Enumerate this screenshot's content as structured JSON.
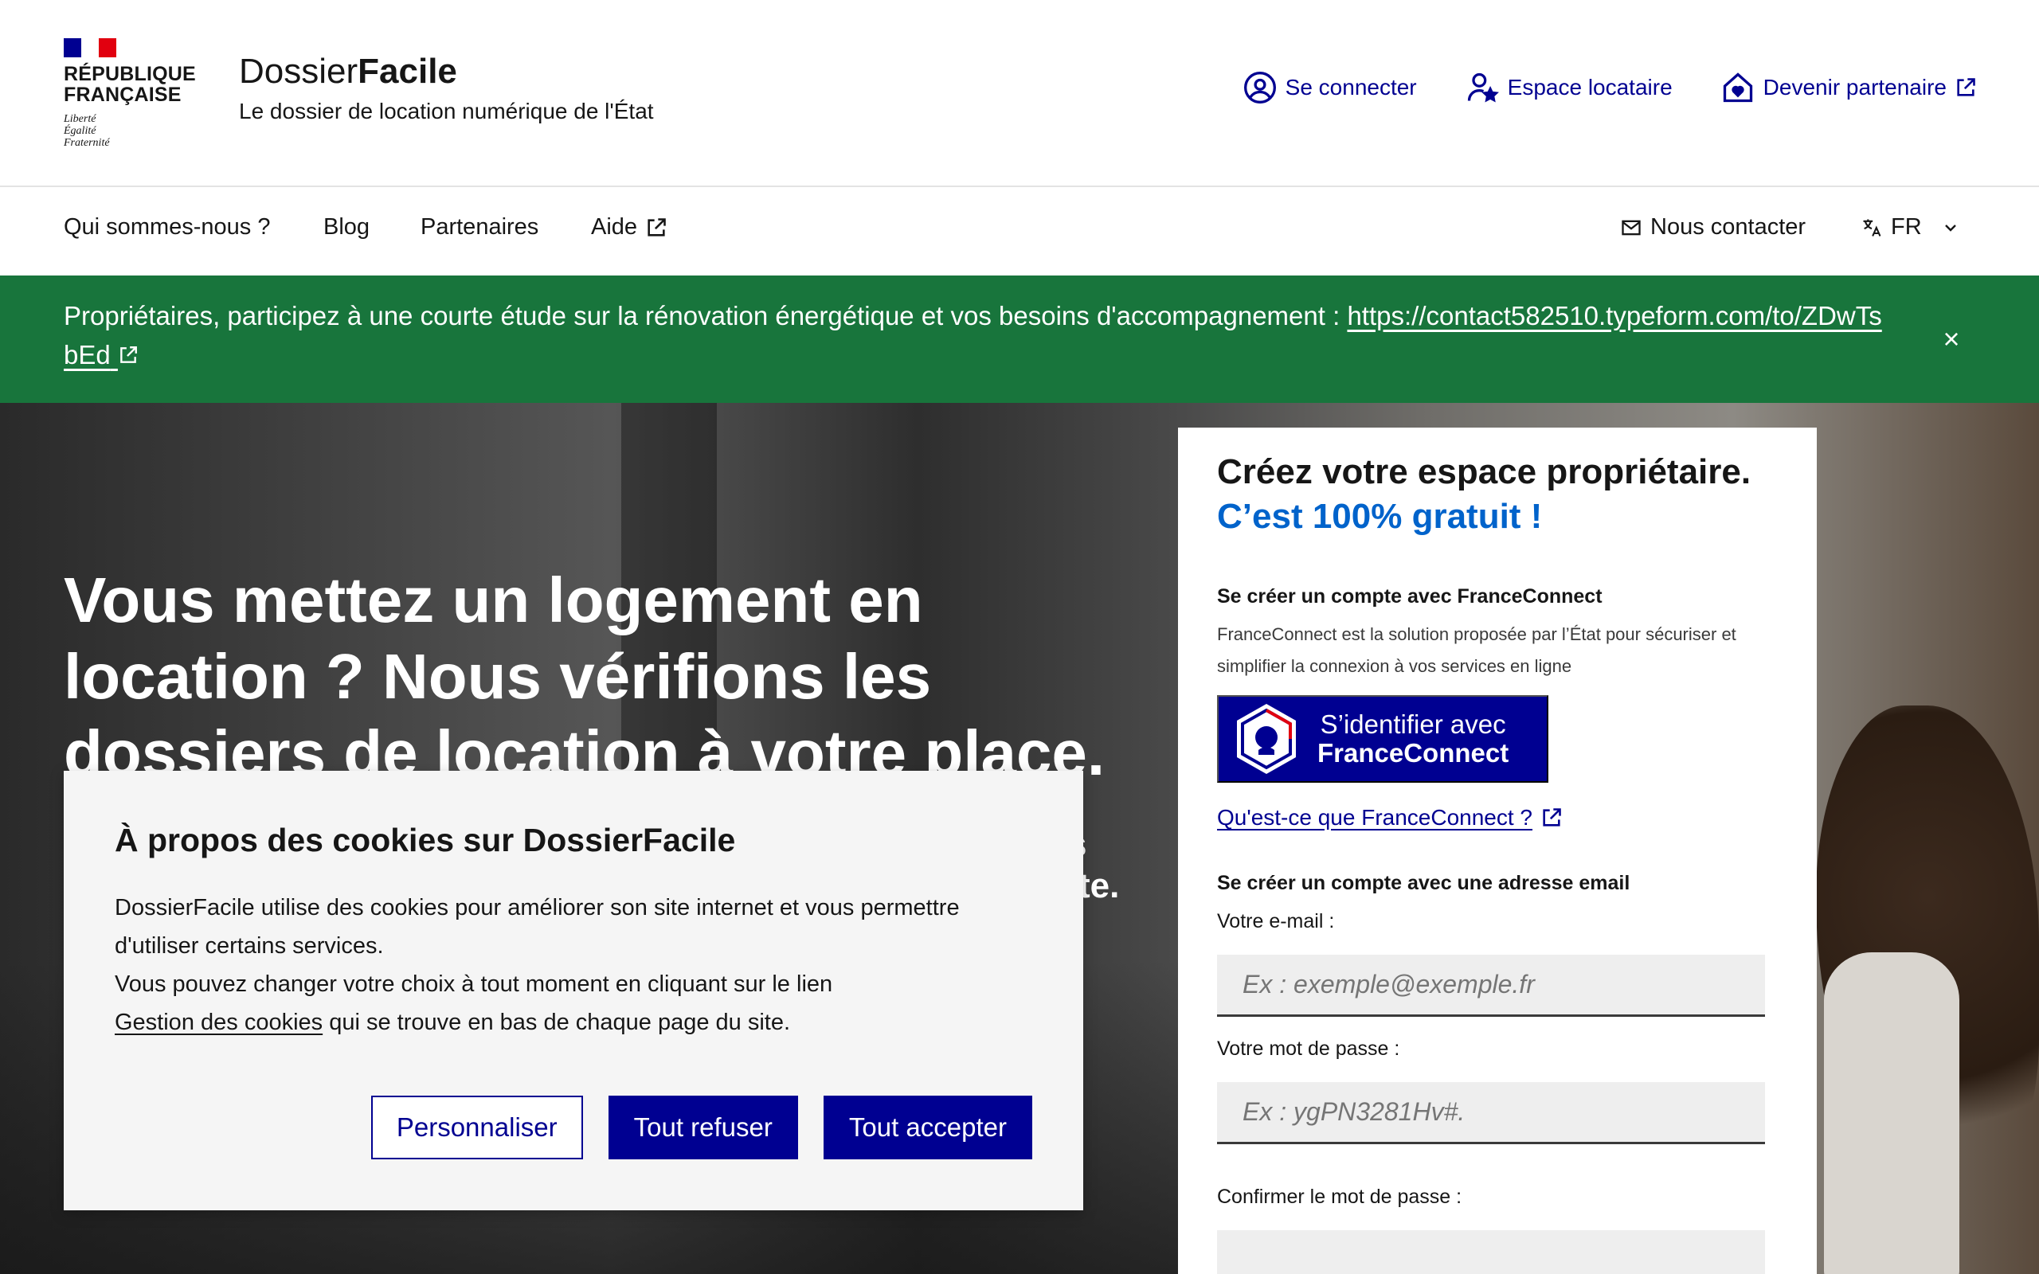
{
  "header": {
    "brand": {
      "line1": "RÉPUBLIQUE",
      "line2": "FRANÇAISE",
      "motto1": "Liberté",
      "motto2": "Égalité",
      "motto3": "Fraternité",
      "flag_colors": [
        "#000091",
        "#ffffff",
        "#e1000f"
      ]
    },
    "service": {
      "title_regular": "Dossier",
      "title_bold": "Facile",
      "tagline": "Le dossier de location numérique de l'État"
    },
    "quick_links": [
      {
        "label": "Se connecter",
        "icon": "user-circle-icon"
      },
      {
        "label": "Espace locataire",
        "icon": "user-star-icon"
      },
      {
        "label": "Devenir partenaire",
        "icon": "home-heart-icon",
        "external": true
      }
    ]
  },
  "nav": {
    "items": [
      {
        "label": "Qui sommes-nous ?"
      },
      {
        "label": "Blog"
      },
      {
        "label": "Partenaires"
      },
      {
        "label": "Aide",
        "external": true
      }
    ],
    "contact_label": "Nous contacter",
    "language": "FR"
  },
  "notice": {
    "text": "Propriétaires, participez à une courte étude sur la rénovation énergétique et vos besoins d'accompagnement : ",
    "link": "https://contact582510.typeform.com/to/ZDwTsbEd",
    "close_label": "×",
    "background": "#18753c"
  },
  "hero": {
    "title": "Vous mettez un logement en location ? Nous vérifions les dossiers de location à votre place.",
    "subtitle_tail_1": "s",
    "subtitle_tail_2": "te."
  },
  "signup": {
    "title_line1": "Créez votre espace propriétaire.",
    "title_line2": "C’est 100% gratuit !",
    "franceconnect": {
      "heading": "Se créer un compte avec FranceConnect",
      "description": "FranceConnect est la solution proposée par l’État pour sécuriser et simplifier la connexion à vos services en ligne",
      "button_line1": "S’identifier avec",
      "button_line2": "FranceConnect",
      "info_link": "Qu'est-ce que FranceConnect ?"
    },
    "email_section": {
      "heading": "Se créer un compte avec une adresse email",
      "email_label": "Votre e-mail :",
      "email_placeholder": "Ex : exemple@exemple.fr",
      "email_value": "",
      "password_label": "Votre mot de passe :",
      "password_placeholder": "Ex : ygPN3281Hv#.",
      "password_value": "",
      "confirm_label": "Confirmer le mot de passe :",
      "confirm_value": ""
    },
    "accent_color": "#0063cb"
  },
  "cookies": {
    "title": "À propos des cookies sur DossierFacile",
    "text1": "DossierFacile utilise des cookies pour améliorer son site internet et vous permettre d'utiliser certains services.",
    "text2": "Vous pouvez changer votre choix à tout moment en cliquant sur le lien ",
    "link": "Gestion des cookies",
    "text3": " qui se trouve en bas de chaque page du site.",
    "buttons": {
      "customize": "Personnaliser",
      "refuse": "Tout refuser",
      "accept": "Tout accepter"
    },
    "primary_color": "#000091"
  }
}
